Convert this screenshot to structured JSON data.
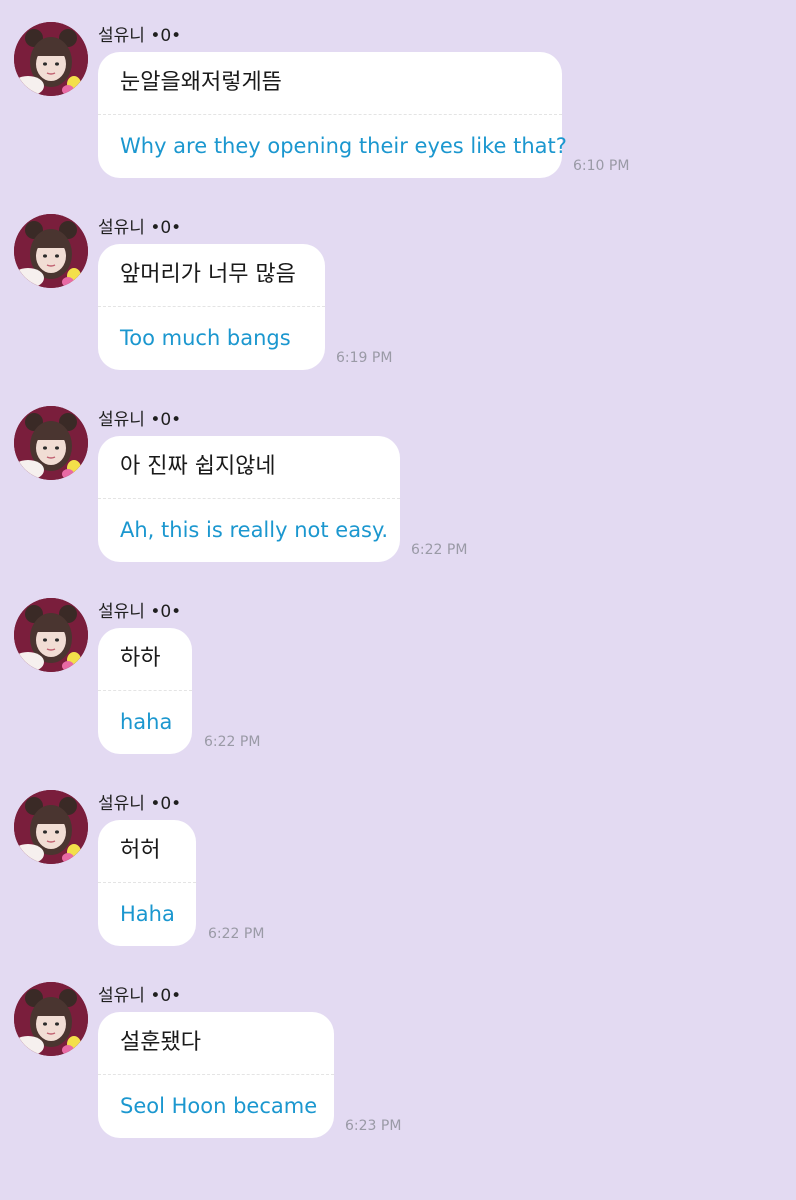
{
  "chat": {
    "messages": [
      {
        "sender": "설유니 •0•",
        "original": "눈알을왜저렇게뜸",
        "translation": "Why are they opening their eyes like that?",
        "time": "6:10 PM"
      },
      {
        "sender": "설유니 •0•",
        "original": "앞머리가 너무 많음",
        "translation": "Too much bangs",
        "time": "6:19 PM"
      },
      {
        "sender": "설유니 •0•",
        "original": "아 진짜 쉽지않네",
        "translation": "Ah, this is really not easy.",
        "time": "6:22 PM"
      },
      {
        "sender": "설유니 •0•",
        "original": "하하",
        "translation": "haha",
        "time": "6:22 PM"
      },
      {
        "sender": "설유니 •0•",
        "original": "허허",
        "translation": "Haha",
        "time": "6:22 PM"
      },
      {
        "sender": "설유니 •0•",
        "original": "설훈됐다",
        "translation": "Seol Hoon became",
        "time": "6:23 PM"
      }
    ]
  },
  "colors": {
    "background": "#e3daf2",
    "bubble": "#ffffff",
    "original_text": "#1a1a1a",
    "translation_text": "#1b97cf",
    "timestamp": "#9a9aa6"
  },
  "icons": {
    "avatar": "profile-photo-avatar"
  }
}
